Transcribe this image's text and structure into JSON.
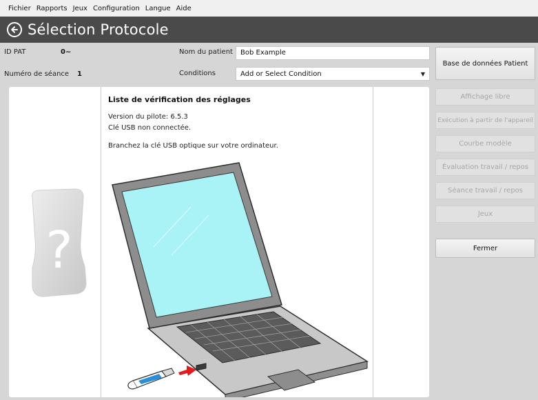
{
  "menu": [
    "Fichier",
    "Rapports",
    "Jeux",
    "Configuration",
    "Langue",
    "Aide"
  ],
  "header": {
    "title": "Sélection Protocole"
  },
  "patient": {
    "id_label": "ID PAT",
    "id_value": "0~",
    "session_label": "Numéro de séance",
    "session_value": "1",
    "name_label": "Nom du patient",
    "name_value": "Bob Example",
    "conditions_label": "Conditions",
    "conditions_value": "Add or Select Condition"
  },
  "sidebar": {
    "patient_db": "Base de données Patient",
    "buttons": [
      {
        "label": "Affichage libre",
        "enabled": false
      },
      {
        "label": "Exécution à partir de l'appareil",
        "enabled": false
      },
      {
        "label": "Courbe modèle",
        "enabled": false
      },
      {
        "label": "Évaluation travail / repos",
        "enabled": false
      },
      {
        "label": "Séance travail / repos",
        "enabled": false
      },
      {
        "label": "Jeux",
        "enabled": false
      },
      {
        "label": "Fermer",
        "enabled": true
      }
    ]
  },
  "checklist": {
    "title": "Liste de vérification des réglages",
    "driver_version": "Version du pilote: 6.5.3",
    "usb_status": "Clé USB non connectée.",
    "instruction": "Branchez la clé USB optique sur votre ordinateur."
  },
  "colors": {
    "title_bar": "#4a4a4a",
    "usb_drive": "#2a8fd8",
    "arrow": "#e01c1c",
    "laptop_screen": "#a9f2f6"
  }
}
